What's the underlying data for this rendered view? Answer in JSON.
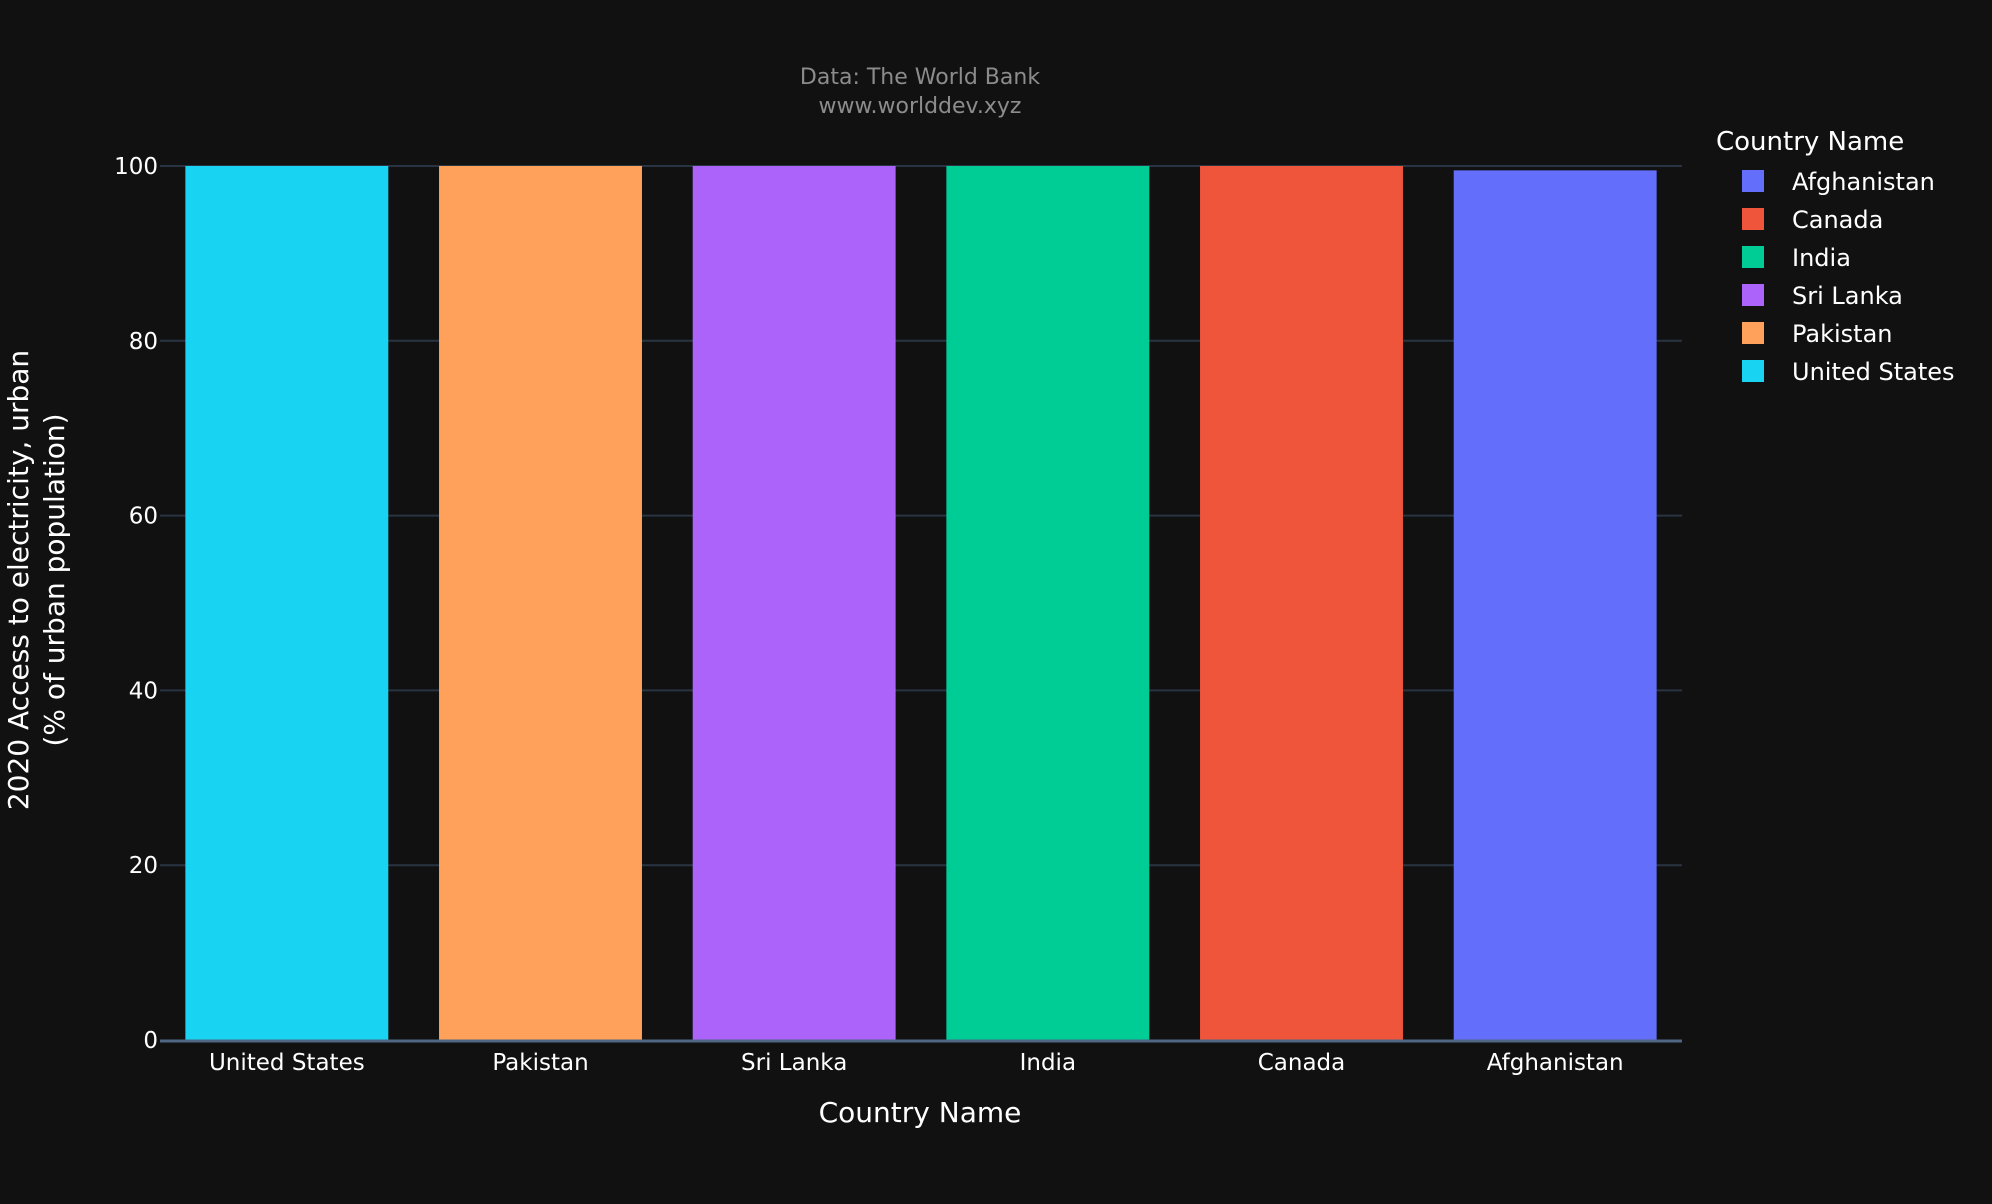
{
  "source": {
    "line1": "Data: The World Bank",
    "line2": "www.worlddev.xyz"
  },
  "legend": {
    "title": "Country Name",
    "position": "top-right"
  },
  "chart_data": {
    "type": "bar",
    "title": "",
    "xlabel": "Country Name",
    "ylabel_lines": [
      "2020 Access to electricity, urban",
      "(% of urban population)"
    ],
    "ylim": [
      0,
      100
    ],
    "yticks": [
      0,
      20,
      40,
      60,
      80,
      100
    ],
    "grid": true,
    "categories": [
      "United States",
      "Pakistan",
      "Sri Lanka",
      "India",
      "Canada",
      "Afghanistan"
    ],
    "series": [
      {
        "name": "United States",
        "values": [
          100
        ],
        "color": "#19D3F3"
      },
      {
        "name": "Pakistan",
        "values": [
          100
        ],
        "color": "#FFA15A"
      },
      {
        "name": "Sri Lanka",
        "values": [
          100
        ],
        "color": "#AB63FA"
      },
      {
        "name": "India",
        "values": [
          100
        ],
        "color": "#00CC96"
      },
      {
        "name": "Canada",
        "values": [
          100
        ],
        "color": "#EF553B"
      },
      {
        "name": "Afghanistan",
        "values": [
          99.5
        ],
        "color": "#636EFA"
      }
    ],
    "legend_order": [
      "Afghanistan",
      "Canada",
      "India",
      "Sri Lanka",
      "Pakistan",
      "United States"
    ]
  }
}
